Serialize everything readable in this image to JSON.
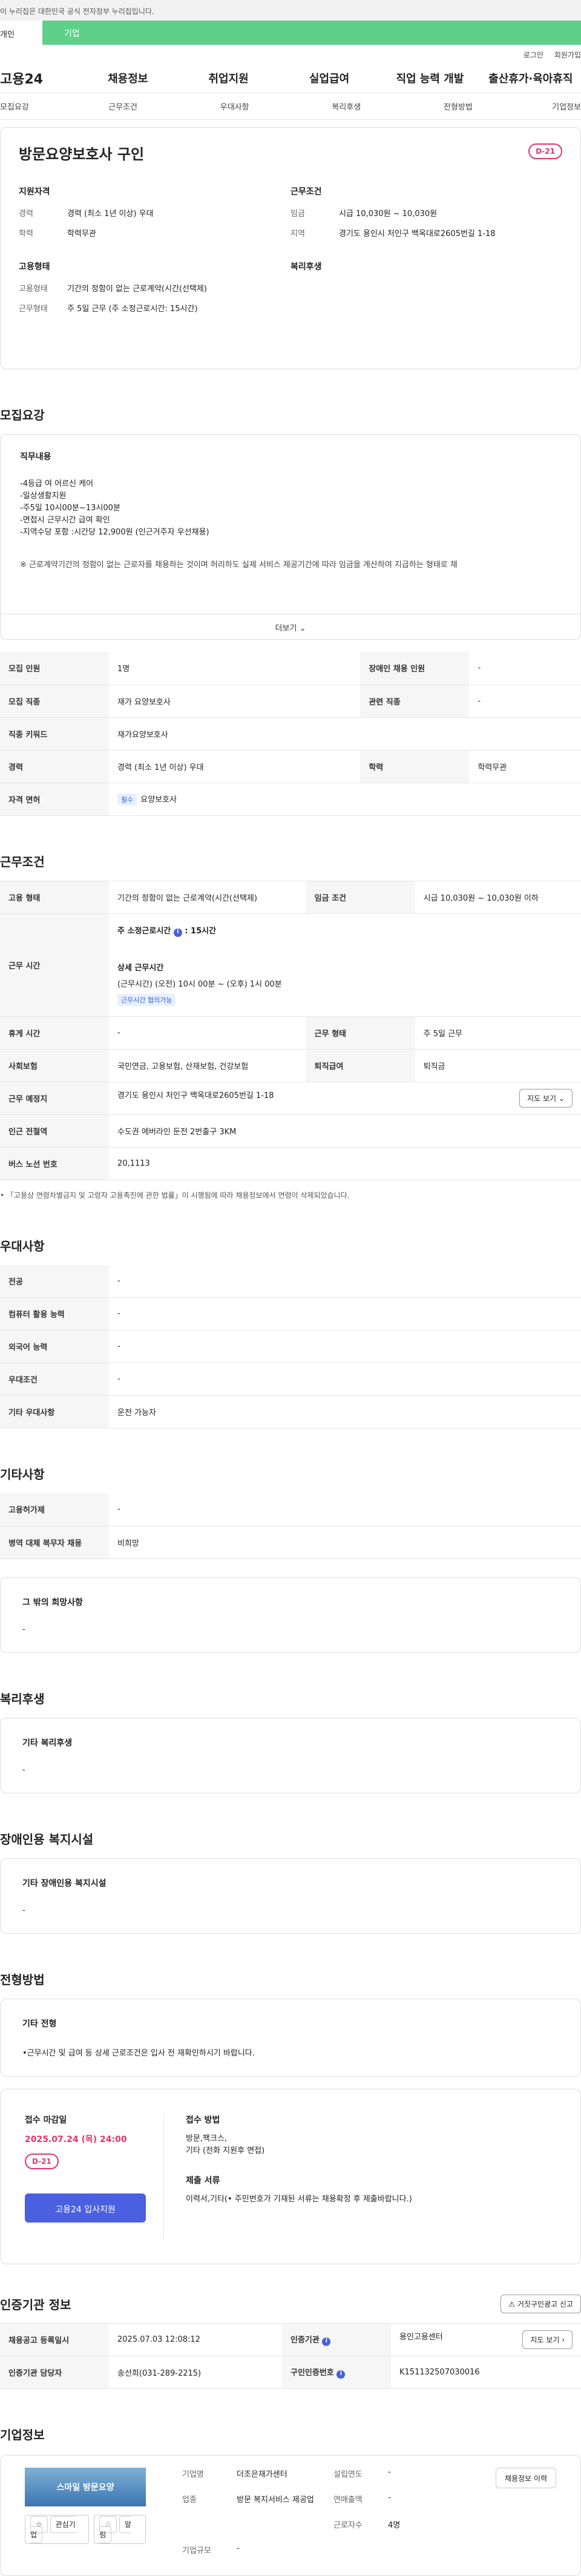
{
  "gov_banner": "이 누리집은 대한민국 공식 전자정부 누리집입니다.",
  "segment": {
    "left": "개인",
    "right": "기업"
  },
  "util": {
    "login": "로그인",
    "signup": "회원가입"
  },
  "logo": "고용24",
  "gnb": [
    "채용정보",
    "취업지원",
    "실업급여",
    "직업 능력 개발",
    "출산휴가·육아휴직"
  ],
  "subnav": [
    "모집요강",
    "근무조건",
    "우대사항",
    "복리후생",
    "전형방법",
    "기업정보"
  ],
  "header": {
    "title": "방문요양보호사 구인",
    "dday": "D-21",
    "qual_title": "지원자격",
    "qual": [
      {
        "k": "경력",
        "v": "경력 (최소 1년 이상) 우대"
      },
      {
        "k": "학력",
        "v": "학력무관"
      }
    ],
    "work_title": "근무조건",
    "work": [
      {
        "k": "임금",
        "v": "시급 10,030원 ~ 10,030원"
      },
      {
        "k": "지역",
        "v": "경기도 용인시 처인구 백옥대로2605번길 1-18"
      }
    ],
    "emp_title": "고용형태",
    "emp": [
      {
        "k": "고용형태",
        "v": "기간의 정함이 없는 근로계약(시간(선택제)"
      },
      {
        "k": "근무형태",
        "v": "주 5일 근무 (주 소정근로시간: 15시간)"
      }
    ],
    "welfare_title": "복리후생"
  },
  "recruit": {
    "heading": "모집요강",
    "duty_title": "직무내용",
    "duty_lines": [
      "-4등급 여 어르신  케어",
      "-일상생활지원",
      "-주5일 10시00분~13시00분",
      "-면접시 근무시간 급여 확인",
      "-지역수당 포함 :시간당 12,900원  (인근거주자 우선채용)"
    ],
    "note": "※ 근로계약기간의 정함이 없는 근로자를 채용하는 것이며 허리하도 실제 서비스 제공기간에 따라 임금을 계산하여 지급하는 형태로 채",
    "more": "더보기",
    "rows": [
      {
        "k1": "모집 인원",
        "v1": "1명",
        "k2": "장애인 채용 인원",
        "v2": "-"
      },
      {
        "k1": "모집 직종",
        "v1": "재가 요양보호사",
        "k2": "관련 직종",
        "v2": "-"
      },
      {
        "k1": "직종 키워드",
        "v1": "재가요양보호사",
        "k2": "",
        "v2": ""
      },
      {
        "k1": "경력",
        "v1": "경력 (최소 1년 이상) 우대",
        "k2": "학력",
        "v2": "학력무관"
      },
      {
        "k1": "자격 면허",
        "tag": "필수",
        "v1": "요양보호사",
        "k2": "",
        "v2": ""
      }
    ]
  },
  "work": {
    "heading": "근무조건",
    "emp_type_k": "고용 형태",
    "emp_type_v": "기간의 정함이 없는 근로계약(시간(선택제)",
    "wage_k": "임금 조건",
    "wage_v": "시급 10,030원 ~ 10,030원 이하",
    "hours_k": "근무 시간",
    "weekly": "주 소정근로시간",
    "weekly_v": "15시간",
    "detail_t": "상세 근무시간",
    "detail_v": "(근무시간) (오전) 10시 00분 ~ (오후) 1시 00분",
    "detail_tag": "근무시간 협의가능",
    "break_k": "휴게 시간",
    "break_v": "-",
    "form_k": "근무 형태",
    "form_v": "주 5일 근무",
    "insure_k": "사회보험",
    "insure_v": "국민연금, 고용보험, 산재보험, 건강보험",
    "retire_k": "퇴직급여",
    "retire_v": "퇴직금",
    "place_k": "근무 예정지",
    "place_v": "경기도 용인시 처인구 백옥대로2605번길 1-18",
    "map_btn": "지도 보기",
    "subway_k": "인근 전철역",
    "subway_v": "수도권 에버라인 둔전 2번출구 3KM",
    "bus_k": "버스 노선 번호",
    "bus_v": "20,1113",
    "footnote": "「고용상 연령차별금지 및 고령자 고용촉진에 관한 법률」이 시행됨에 따라 채용정보에서 연령이 삭제되었습니다."
  },
  "pref": {
    "heading": "우대사항",
    "rows": [
      {
        "k": "전공",
        "v": "-"
      },
      {
        "k": "컴퓨터 활용 능력",
        "v": "-"
      },
      {
        "k": "외국어 능력",
        "v": "-"
      },
      {
        "k": "우대조건",
        "v": "-"
      },
      {
        "k": "기타 우대사항",
        "v": "운전 가능자"
      }
    ]
  },
  "etc": {
    "heading": "기타사항",
    "rows": [
      {
        "k": "고용허가제",
        "v": "-"
      },
      {
        "k": "병역 대체 복무자 채용",
        "v": "비희망"
      }
    ],
    "other_t": "그 밖의 희망사항",
    "other_v": "-"
  },
  "welfare": {
    "heading": "복리후생",
    "t": "기타 복리후생",
    "v": "-"
  },
  "disability": {
    "heading": "장애인용 복지시설",
    "t": "기타 장애인용 복지시설",
    "v": "-"
  },
  "process": {
    "heading": "전형방법",
    "t": "기타 전형",
    "v": "•근무시간 및 급여 등 상세 근로조건은 입사 전 재확인하시기 바랍니다.",
    "deadline_t": "접수 마감일",
    "deadline_v": "2025.07.24 (목) 24:00",
    "dday": "D-21",
    "apply_btn": "고용24 입사지원",
    "method_t": "접수 방법",
    "method_v": "방문,팩크스,",
    "method_v2": "기타 (전화 지원후 면접)",
    "docs_t": "제출 서류",
    "docs_v": "이력서,기타(• 주민번호가 기재된 서류는 채용확정 후 제출바랍니다.)"
  },
  "agency": {
    "heading": "인증기관 정보",
    "report_btn": "거짓구인광고 신고",
    "rows": [
      {
        "k1": "채용공고 등록일시",
        "v1": "2025.07.03 12:08:12",
        "k2": "인증기관",
        "v2": "용인고용센터"
      },
      {
        "k1": "인증기관 담당자",
        "v1": "송선희(031-289-2215)",
        "k2": "구인인증번호",
        "v2": "K151132507030016"
      }
    ],
    "map_btn": "지도 보기"
  },
  "company": {
    "heading": "기업정보",
    "img_text": "스마일 방문요양",
    "fav": "관심기업",
    "alarm": "알림",
    "name_k": "기업명",
    "name_v": "더조은재가센터",
    "year_k": "설립연도",
    "year_v": "-",
    "ind_k": "업종",
    "ind_v": "방문 복지서비스 제공업",
    "sales_k": "연매출액",
    "sales_v": "-",
    "emp_k": "근로자수",
    "emp_v": "4명",
    "scale_k": "기업규모",
    "scale_v": "-",
    "recruit_btn": "채용정보 이력"
  }
}
